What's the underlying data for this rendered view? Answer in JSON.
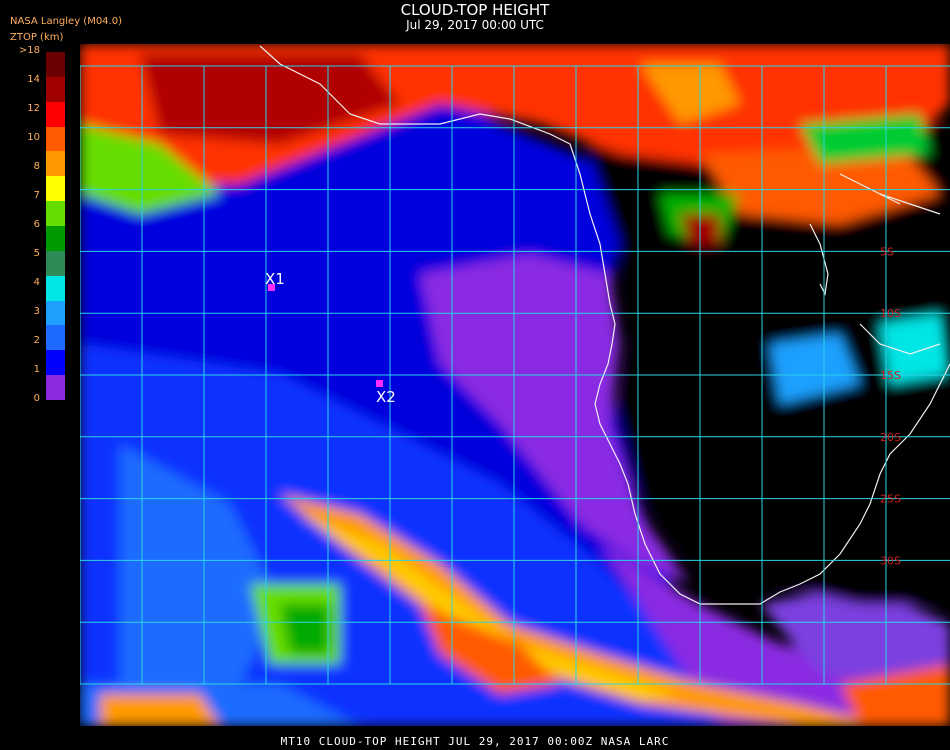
{
  "header": {
    "title": "CLOUD-TOP HEIGHT",
    "subtitle": "Jul 29, 2017 00:00 UTC",
    "source": "NASA Langley (M04.0)",
    "units": "ZTOP (km)"
  },
  "legend": {
    "labels": [
      "0",
      "1",
      "2",
      "3",
      "4",
      "5",
      "6",
      "7",
      "8",
      "10",
      "12",
      "14",
      ">18"
    ],
    "colors": [
      "#8a2be2",
      "#0000ff",
      "#1e6cff",
      "#1ea0ff",
      "#00e5e5",
      "#2e8b57",
      "#009900",
      "#66dd00",
      "#ffff00",
      "#ff9900",
      "#ff5a00",
      "#ff0000",
      "#a00000",
      "#6b0000"
    ]
  },
  "markers": [
    {
      "label": "X1"
    },
    {
      "label": "X2"
    }
  ],
  "lat_labels": [
    "5S",
    "10S",
    "15S",
    "20S",
    "25S",
    "30S"
  ],
  "footer": "MT10  CLOUD-TOP HEIGHT   JUL 29, 2017 00:00Z   NASA LARC"
}
